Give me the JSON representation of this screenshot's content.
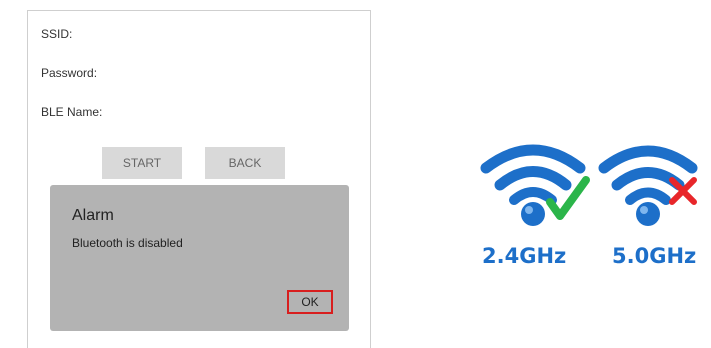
{
  "form": {
    "ssid_label": "SSID:",
    "password_label": "Password:",
    "ble_name_label": "BLE Name:",
    "start_label": "START",
    "back_label": "BACK"
  },
  "dialog": {
    "title": "Alarm",
    "message": "Bluetooth is disabled",
    "ok_label": "OK"
  },
  "wifi_bands": [
    {
      "label": "2.4GHz",
      "status": "supported",
      "status_icon": "check-icon",
      "status_color": "#2bb54a"
    },
    {
      "label": "5.0GHz",
      "status": "unsupported",
      "status_icon": "cross-icon",
      "status_color": "#e8262a"
    }
  ],
  "colors": {
    "wifi_blue": "#1d6fc9",
    "ok_border": "#d81e1e",
    "dialog_bg": "#b3b3b3",
    "button_bg": "#d9d9d9"
  }
}
